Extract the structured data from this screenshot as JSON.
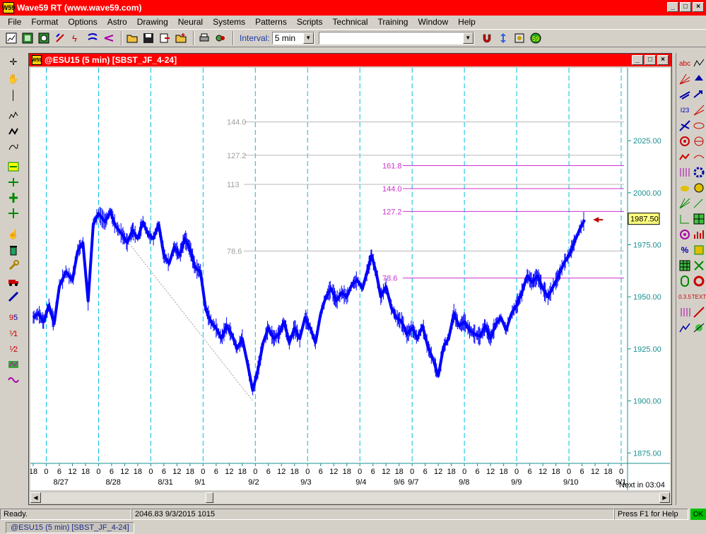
{
  "app": {
    "title": "Wave59 RT (www.wave59.com)",
    "icon_text": "W59"
  },
  "menu": [
    "File",
    "Format",
    "Options",
    "Astro",
    "Drawing",
    "Neural",
    "Systems",
    "Patterns",
    "Scripts",
    "Technical",
    "Training",
    "Window",
    "Help"
  ],
  "toolbar": {
    "interval_label": "Interval:",
    "interval_value": "5 min",
    "symbol_value": ""
  },
  "chart_window": {
    "title": "@ESU15 (5 min) [SBST_JF_4-24]"
  },
  "chart_data": {
    "type": "line",
    "ylim": [
      1870,
      2060
    ],
    "y_ticks": [
      {
        "value": 2025,
        "label": "2025.00"
      },
      {
        "value": 2000,
        "label": "2000.00"
      },
      {
        "value": 1975,
        "label": "1975.00"
      },
      {
        "value": 1950,
        "label": "1950.00"
      },
      {
        "value": 1925,
        "label": "1925.00"
      },
      {
        "value": 1900,
        "label": "1900.00"
      },
      {
        "value": 1875,
        "label": "1875.00"
      }
    ],
    "current_price": {
      "value": 1987.5,
      "label": "1987.50"
    },
    "gray_fib_levels": [
      {
        "label": "144.0",
        "value": 2034
      },
      {
        "label": "127.2",
        "value": 2018
      },
      {
        "label": "113",
        "value": 2004
      },
      {
        "label": "78.6",
        "value": 1972
      }
    ],
    "magenta_fib_levels": [
      {
        "label": "161.8",
        "value": 2013
      },
      {
        "label": "144.0",
        "value": 2002
      },
      {
        "label": "127.2",
        "value": 1991
      },
      {
        "label": "78.6",
        "value": 1959
      }
    ],
    "hour_labels": [
      "18",
      "0",
      "6",
      "12",
      "18",
      "0",
      "6",
      "12",
      "18",
      "0",
      "6",
      "12",
      "18",
      "0",
      "6",
      "12",
      "18",
      "0",
      "6",
      "12",
      "18",
      "0",
      "6",
      "12",
      "18",
      "0",
      "6",
      "12",
      "18",
      "0",
      "6",
      "12",
      "18",
      "0",
      "6",
      "12",
      "18",
      "0",
      "6",
      "12",
      "18",
      "0",
      "6",
      "12",
      "18",
      "0"
    ],
    "date_labels": [
      "8/27",
      "8/28",
      "8/31",
      "9/1",
      "9/2",
      "9/3",
      "9/4",
      "9/6",
      "9/7",
      "9/8",
      "9/9",
      "9/10",
      "9/1"
    ],
    "price_path": [
      [
        0,
        1940
      ],
      [
        0.4,
        1942
      ],
      [
        0.8,
        1938
      ],
      [
        1.2,
        1946
      ],
      [
        1.6,
        1937
      ],
      [
        2.0,
        1955
      ],
      [
        2.5,
        1962
      ],
      [
        3.0,
        1958
      ],
      [
        3.4,
        1972
      ],
      [
        3.8,
        1976
      ],
      [
        4.2,
        1948
      ],
      [
        4.6,
        1985
      ],
      [
        5.0,
        1990
      ],
      [
        5.5,
        1986
      ],
      [
        5.9,
        1991
      ],
      [
        6.3,
        1984
      ],
      [
        6.8,
        1980
      ],
      [
        7.2,
        1976
      ],
      [
        7.6,
        1982
      ],
      [
        8.0,
        1978
      ],
      [
        8.4,
        1986
      ],
      [
        8.8,
        1980
      ],
      [
        9.2,
        1978
      ],
      [
        9.6,
        1985
      ],
      [
        10.0,
        1970
      ],
      [
        10.4,
        1966
      ],
      [
        10.8,
        1974
      ],
      [
        11.2,
        1970
      ],
      [
        11.6,
        1978
      ],
      [
        12.0,
        1973
      ],
      [
        12.4,
        1964
      ],
      [
        12.8,
        1962
      ],
      [
        13.2,
        1944
      ],
      [
        13.6,
        1938
      ],
      [
        14.0,
        1935
      ],
      [
        14.4,
        1930
      ],
      [
        14.8,
        1936
      ],
      [
        15.2,
        1932
      ],
      [
        15.6,
        1925
      ],
      [
        16.0,
        1930
      ],
      [
        16.4,
        1918
      ],
      [
        16.8,
        1905
      ],
      [
        17.2,
        1915
      ],
      [
        17.6,
        1928
      ],
      [
        18.0,
        1935
      ],
      [
        18.4,
        1930
      ],
      [
        18.8,
        1932
      ],
      [
        19.2,
        1938
      ],
      [
        19.6,
        1928
      ],
      [
        20.0,
        1935
      ],
      [
        20.4,
        1930
      ],
      [
        20.8,
        1940
      ],
      [
        21.2,
        1935
      ],
      [
        21.6,
        1928
      ],
      [
        22.0,
        1942
      ],
      [
        22.4,
        1950
      ],
      [
        22.8,
        1954
      ],
      [
        23.2,
        1948
      ],
      [
        23.6,
        1952
      ],
      [
        24.0,
        1950
      ],
      [
        24.4,
        1956
      ],
      [
        24.8,
        1958
      ],
      [
        25.2,
        1954
      ],
      [
        25.6,
        1963
      ],
      [
        25.9,
        1970
      ],
      [
        26.3,
        1960
      ],
      [
        26.6,
        1950
      ],
      [
        27.0,
        1955
      ],
      [
        27.4,
        1945
      ],
      [
        27.8,
        1940
      ],
      [
        28.2,
        1938
      ],
      [
        28.6,
        1932
      ],
      [
        29.0,
        1935
      ],
      [
        29.4,
        1930
      ],
      [
        29.8,
        1936
      ],
      [
        30.2,
        1926
      ],
      [
        30.6,
        1920
      ],
      [
        31.0,
        1912
      ],
      [
        31.4,
        1926
      ],
      [
        31.8,
        1930
      ],
      [
        32.2,
        1942
      ],
      [
        32.6,
        1936
      ],
      [
        33.0,
        1938
      ],
      [
        33.4,
        1934
      ],
      [
        33.8,
        1932
      ],
      [
        34.2,
        1931
      ],
      [
        34.6,
        1936
      ],
      [
        35.0,
        1930
      ],
      [
        35.4,
        1937
      ],
      [
        35.8,
        1940
      ],
      [
        36.2,
        1934
      ],
      [
        36.6,
        1942
      ],
      [
        37.0,
        1946
      ],
      [
        37.4,
        1952
      ],
      [
        37.8,
        1960
      ],
      [
        38.2,
        1957
      ],
      [
        38.6,
        1960
      ],
      [
        39.0,
        1954
      ],
      [
        39.4,
        1950
      ],
      [
        39.8,
        1955
      ],
      [
        40.2,
        1960
      ],
      [
        40.6,
        1966
      ],
      [
        41.0,
        1970
      ],
      [
        41.4,
        1976
      ],
      [
        41.8,
        1982
      ],
      [
        42.2,
        1987
      ]
    ],
    "trendline": [
      [
        6.3,
        1984
      ],
      [
        16.8,
        1900
      ]
    ]
  },
  "status": {
    "ready": "Ready.",
    "info": "2046.83  9/3/2015  1015",
    "help": "Press F1 for Help",
    "ok": "OK",
    "next_bar": "Next in 03:04"
  },
  "taskbar": {
    "tab": "@ESU15 (5 min) [SBST_JF_4-24]"
  },
  "colors": {
    "title_red": "#ff0000",
    "price_blue": "#0000ff",
    "magenta": "#cc33cc",
    "grid_cyan": "#00c0e0",
    "axis_teal": "#1a9090"
  }
}
